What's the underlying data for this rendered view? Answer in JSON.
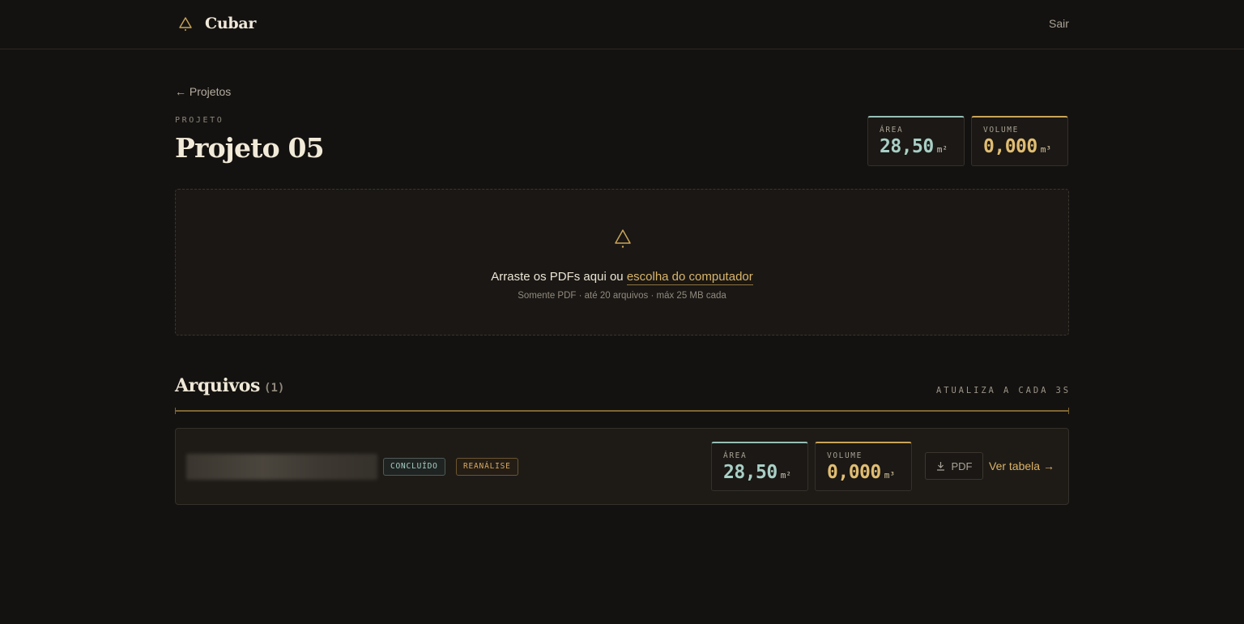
{
  "app": {
    "name": "Cubar"
  },
  "header": {
    "logout_label": "Sair"
  },
  "nav": {
    "back_label": "← Projetos"
  },
  "project": {
    "eyebrow": "PROJETO",
    "title": "Projeto 05"
  },
  "totals": {
    "area": {
      "label": "ÁREA",
      "value": "28,50",
      "unit": "m²"
    },
    "volume": {
      "label": "VOLUME",
      "value": "0,000",
      "unit": "m³"
    }
  },
  "dropzone": {
    "text": "Arraste os PDFs aqui ou",
    "link": "escolha do computador",
    "subtext": "Somente PDF · até 20 arquivos · máx 25 MB cada"
  },
  "files_section": {
    "title": "Arquivos",
    "count": "(1)",
    "note": "ATUALIZA A CADA 3S"
  },
  "files": [
    {
      "status": "CONCLUÍDO",
      "tag": "REANÁLISE",
      "area": {
        "label": "ÁREA",
        "value": "28,50",
        "unit": "m²"
      },
      "volume": {
        "label": "VOLUME",
        "value": "0,000",
        "unit": "m³"
      },
      "pdf_label": "PDF",
      "table_link": "Ver tabela →"
    }
  ],
  "colors": {
    "accent_gold": "#d9b56a",
    "accent_teal": "#a8cfc5",
    "background": "#141210"
  }
}
